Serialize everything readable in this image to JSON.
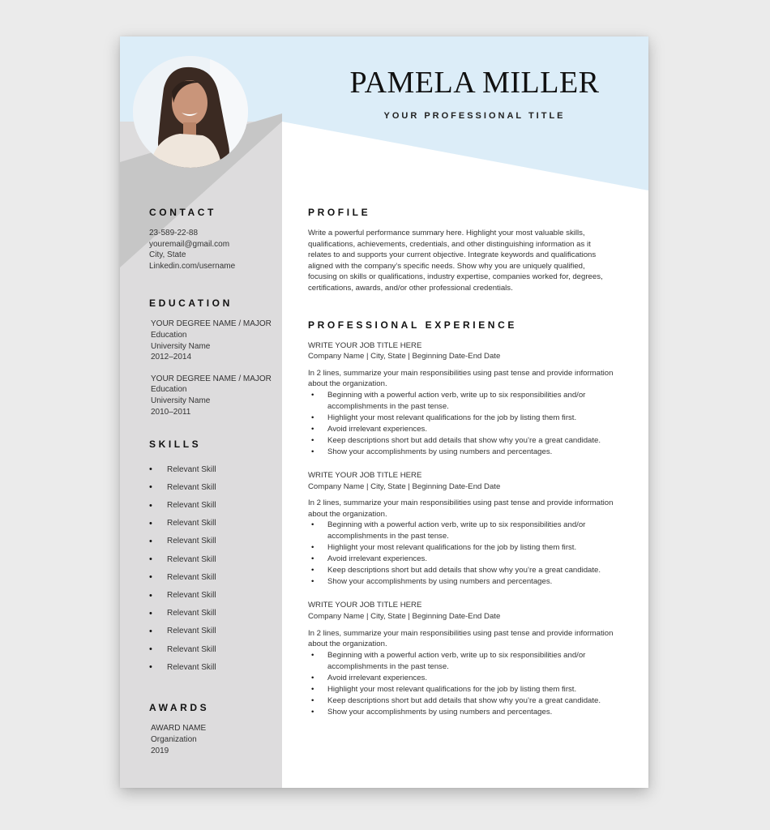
{
  "colors": {
    "header_blue": "#dcedf8",
    "sidebar_gray": "#dddcdd",
    "sidebar_dark": "#c6c6c6",
    "text": "#333333"
  },
  "header": {
    "name": "PAMELA MILLER",
    "title": "YOUR PROFESSIONAL TITLE",
    "photo": "profile-photo"
  },
  "sidebar": {
    "contact": {
      "heading": "CONTACT",
      "lines": [
        "23-589-22-88",
        "youremail@gmail.com",
        "City, State",
        "Linkedin.com/username"
      ]
    },
    "education": {
      "heading": "EDUCATION",
      "entries": [
        {
          "degree": "YOUR DEGREE NAME / MAJOR",
          "field": "Education",
          "school": "University Name",
          "years": "2012–2014"
        },
        {
          "degree": "YOUR DEGREE NAME / MAJOR",
          "field": "Education",
          "school": "University Name",
          "years": "2010–2011"
        }
      ]
    },
    "skills": {
      "heading": "SKILLS",
      "bullet": "•",
      "items": [
        "Relevant Skill",
        "Relevant Skill",
        "Relevant Skill",
        "Relevant Skill",
        "Relevant Skill",
        "Relevant Skill",
        "Relevant Skill",
        "Relevant Skill",
        "Relevant Skill",
        "Relevant Skill",
        "Relevant Skill",
        "Relevant Skill"
      ]
    },
    "awards": {
      "heading": "AWARDS",
      "name": "AWARD NAME",
      "organization": "Organization",
      "year": "2019"
    }
  },
  "main": {
    "profile": {
      "heading": "PROFILE",
      "text": "Write a powerful performance summary here. Highlight your most valuable skills, qualifications, achievements, credentials, and other distinguishing information as it relates to and supports your current objective. Integrate keywords and qualifications aligned with the company’s specific needs. Show why you are uniquely qualified, focusing on skills or qualifications, industry expertise, companies worked for, degrees, certifications, awards, and/or other professional credentials."
    },
    "experience": {
      "heading": "PROFESSIONAL EXPERIENCE",
      "bullet": "•",
      "jobs": [
        {
          "title": "WRITE YOUR JOB TITLE HERE",
          "meta": "Company Name | City, State | Beginning Date-End Date",
          "summary": "In 2 lines, summarize your main responsibilities using past tense and provide information about the organization.",
          "bullets": [
            "Beginning with a powerful action verb, write up to six responsibilities and/or accomplishments in the past tense.",
            "Highlight your most relevant qualifications for the job by listing them first.",
            "Avoid irrelevant experiences.",
            "Keep descriptions short but add details that show why you’re a great candidate.",
            "Show your accomplishments by using numbers and percentages."
          ]
        },
        {
          "title": "WRITE YOUR JOB TITLE HERE",
          "meta": "Company Name | City, State | Beginning Date-End Date",
          "summary": "In 2 lines, summarize your main responsibilities using past tense and provide information about the organization.",
          "bullets": [
            "Beginning with a powerful action verb, write up to six responsibilities and/or accomplishments in the past tense.",
            "Highlight your most relevant qualifications for the job by listing them first.",
            "Avoid irrelevant experiences.",
            "Keep descriptions short but add details that show why you’re a great candidate.",
            "Show your accomplishments by using numbers and percentages."
          ]
        },
        {
          "title": "WRITE YOUR JOB TITLE HERE",
          "meta": "Company Name | City, State | Beginning Date-End Date",
          "summary": "In 2 lines, summarize your main responsibilities using past tense and provide information about the organization.",
          "bullets": [
            "Beginning with a powerful action verb, write up to six responsibilities and/or accomplishments in the past tense.",
            "Avoid irrelevant experiences.",
            "Highlight your most relevant qualifications for the job by listing them first.",
            "Keep descriptions short but add details that show why you’re a great candidate.",
            "Show your accomplishments by using numbers and percentages."
          ]
        }
      ]
    }
  }
}
